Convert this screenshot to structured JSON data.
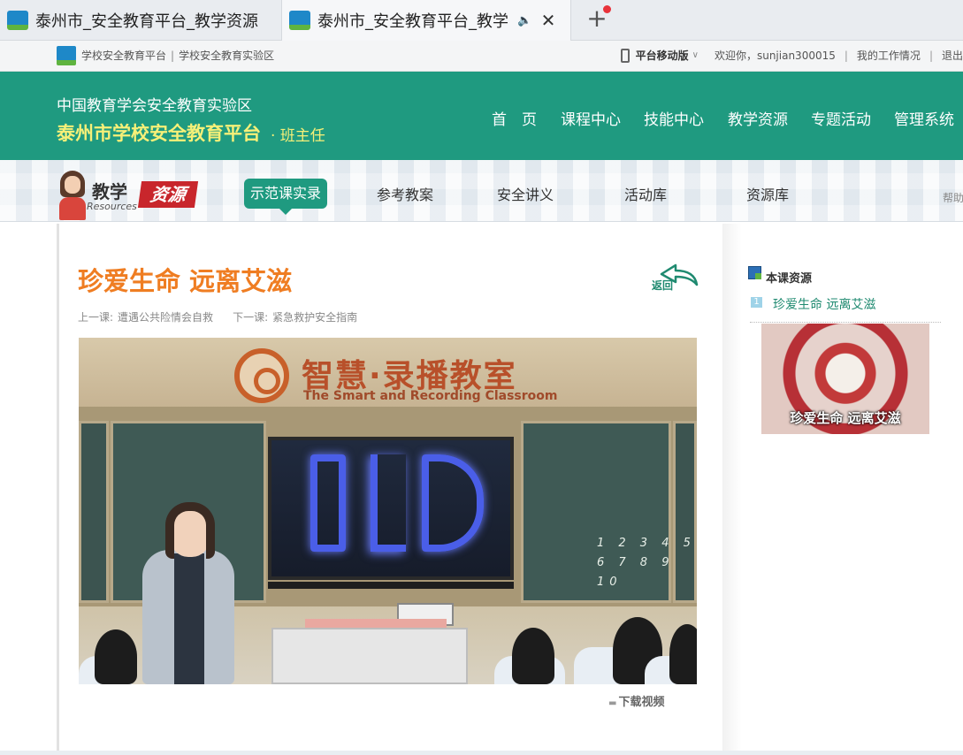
{
  "browser": {
    "tabs": [
      {
        "title": "泰州市_安全教育平台_教学资源"
      },
      {
        "title": "泰州市_安全教育平台_教学资源"
      }
    ],
    "new_tab_symbol": "+",
    "close_symbol": "✕",
    "audio_symbol": "🔈"
  },
  "topstrip": {
    "site_name": "学校安全教育平台",
    "separator": "|",
    "zone_name": "学校安全教育实验区",
    "mobile_label": "平台移动版",
    "caret": "∨",
    "welcome": "欢迎你，sunjian300015",
    "my_work": "我的工作情况",
    "logout": "退出"
  },
  "header": {
    "org": "中国教育学会安全教育实验区",
    "title": "泰州市学校安全教育平台",
    "role": "· 班主任",
    "nav": [
      "首　页",
      "课程中心",
      "技能中心",
      "教学资源",
      "专题活动",
      "管理系统"
    ]
  },
  "subnav": {
    "logo_jx": "教学",
    "logo_resources": "Resources",
    "logo_zy": "资源",
    "items": [
      "示范课实录",
      "参考教案",
      "安全讲义",
      "活动库",
      "资源库"
    ],
    "help": "帮助"
  },
  "lesson": {
    "title": "珍爱生命 远离艾滋",
    "return_label": "返回",
    "prev_label": "上一课:",
    "prev_value": "遭遇公共险情会自救",
    "next_label": "下一课:",
    "next_value": "紧急救护安全指南",
    "download_label": "下载视频"
  },
  "video": {
    "sign_cn": "智慧·录播教室",
    "sign_en": "The Smart and Recording Classroom",
    "board_numbers_row1": "1 2 3 4 5",
    "board_numbers_row2": "6 7 8 9 10"
  },
  "sidebar": {
    "heading": "本课资源",
    "items": [
      {
        "index": "1",
        "label": "珍爱生命 远离艾滋"
      }
    ],
    "thumb_caption": "珍爱生命 远离艾滋"
  },
  "colors": {
    "brand_green": "#1f9a80",
    "title_yellow": "#f6f078",
    "lesson_orange": "#ef7d22",
    "link_green": "#1f8a70"
  }
}
